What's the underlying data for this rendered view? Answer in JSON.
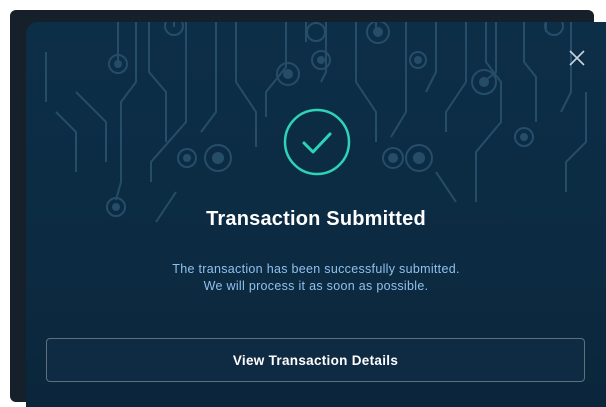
{
  "modal": {
    "title": "Transaction Submitted",
    "message_line1": "The transaction has been successfully submitted.",
    "message_line2": "We will process it as soon as possible.",
    "button_label": "View Transaction Details",
    "close_icon": "close-icon",
    "status_icon": "checkmark-circle-icon"
  },
  "colors": {
    "modal_background": "#0c2c44",
    "accent": "#2ed3b7",
    "message_text": "#8fc1ee",
    "circuit_lines": "#2f5875"
  }
}
